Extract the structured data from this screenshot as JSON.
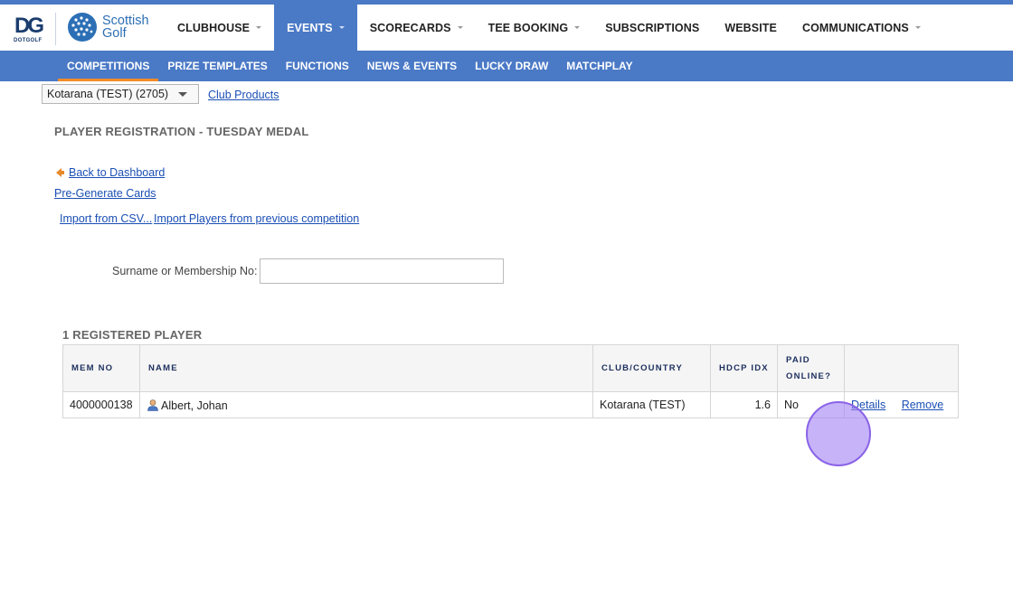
{
  "brand": {
    "dotgolf_mark": "DG",
    "dotgolf_text": "DOTGOLF",
    "partner_line1": "Scottish",
    "partner_line2": "Golf"
  },
  "nav": {
    "items": [
      {
        "label": "CLUBHOUSE"
      },
      {
        "label": "EVENTS"
      },
      {
        "label": "SCORECARDS"
      },
      {
        "label": "TEE BOOKING"
      },
      {
        "label": "SUBSCRIPTIONS"
      },
      {
        "label": "WEBSITE"
      },
      {
        "label": "COMMUNICATIONS"
      }
    ],
    "active": "EVENTS"
  },
  "subnav": {
    "items": [
      {
        "label": "COMPETITIONS"
      },
      {
        "label": "PRIZE TEMPLATES"
      },
      {
        "label": "FUNCTIONS"
      },
      {
        "label": "NEWS & EVENTS"
      },
      {
        "label": "LUCKY DRAW"
      },
      {
        "label": "MATCHPLAY"
      }
    ],
    "active": "COMPETITIONS"
  },
  "club_selector": {
    "selected": "Kotarana (TEST) (2705)"
  },
  "links": {
    "club_products": "Club Products",
    "back": "Back to Dashboard",
    "pregenerate": "Pre-Generate Cards",
    "import_csv": "Import from CSV...",
    "import_prev": "Import Players from previous competition"
  },
  "page_title": "PLAYER REGISTRATION - TUESDAY MEDAL",
  "search": {
    "label": "Surname or Membership No:",
    "value": ""
  },
  "registered": {
    "title": "1 REGISTERED PLAYER",
    "headers": {
      "mem_no": "MEM NO",
      "name": "NAME",
      "club": "CLUB/COUNTRY",
      "hdcp": "HDCP IDX",
      "paid_1": "PAID",
      "paid_2": "ONLINE?"
    },
    "rows": [
      {
        "mem_no": "4000000138",
        "name": "Albert, Johan",
        "club": "Kotarana (TEST)",
        "hdcp": "1.6",
        "paid": "No",
        "details": "Details",
        "remove": "Remove"
      }
    ]
  },
  "colors": {
    "primary": "#4a79c6",
    "accent": "#f28c28",
    "link": "#1a4fb4"
  }
}
